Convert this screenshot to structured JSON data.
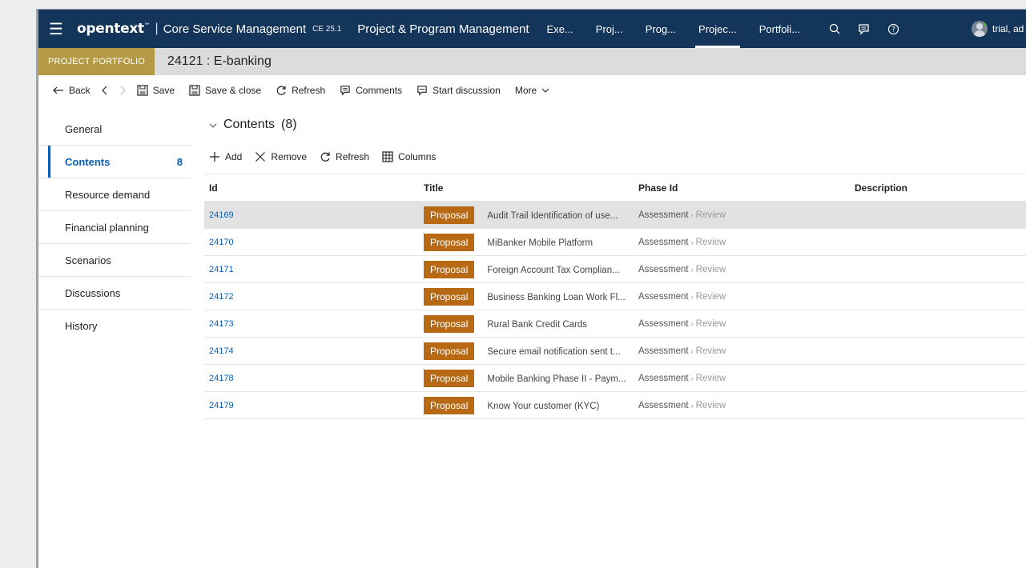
{
  "topbar": {
    "brand": "opentext",
    "product": "Core Service Management",
    "version": "CE 25.1",
    "module": "Project & Program Management",
    "nav": [
      "Exe...",
      "Proj...",
      "Prog...",
      "Projec...",
      "Portfoli..."
    ],
    "user": "trial, ad"
  },
  "titlebar": {
    "badge": "PROJECT PORTFOLIO",
    "title": "24121 : E-banking"
  },
  "toolbar": {
    "back": "Back",
    "save": "Save",
    "save_close": "Save & close",
    "refresh": "Refresh",
    "comments": "Comments",
    "start_discussion": "Start discussion",
    "more": "More"
  },
  "sidebar": {
    "items": [
      {
        "label": "General",
        "count": ""
      },
      {
        "label": "Contents",
        "count": "8"
      },
      {
        "label": "Resource demand",
        "count": ""
      },
      {
        "label": "Financial planning",
        "count": ""
      },
      {
        "label": "Scenarios",
        "count": ""
      },
      {
        "label": "Discussions",
        "count": ""
      },
      {
        "label": "History",
        "count": ""
      }
    ]
  },
  "contents": {
    "heading": "Contents",
    "count": "(8)",
    "actions": {
      "add": "Add",
      "remove": "Remove",
      "refresh": "Refresh",
      "columns": "Columns"
    },
    "columns": [
      "Id",
      "Title",
      "Phase Id",
      "Description"
    ],
    "rows": [
      {
        "id": "24169",
        "badge": "Proposal",
        "title": "Audit Trail Identification of use...",
        "phase": "Assessment",
        "sub": "Review"
      },
      {
        "id": "24170",
        "badge": "Proposal",
        "title": "MiBanker Mobile Platform",
        "phase": "Assessment",
        "sub": "Review"
      },
      {
        "id": "24171",
        "badge": "Proposal",
        "title": "Foreign Account Tax Complian...",
        "phase": "Assessment",
        "sub": "Review"
      },
      {
        "id": "24172",
        "badge": "Proposal",
        "title": "Business Banking Loan Work Fl...",
        "phase": "Assessment",
        "sub": "Review"
      },
      {
        "id": "24173",
        "badge": "Proposal",
        "title": "Rural Bank Credit Cards",
        "phase": "Assessment",
        "sub": "Review"
      },
      {
        "id": "24174",
        "badge": "Proposal",
        "title": "Secure email notification sent t...",
        "phase": "Assessment",
        "sub": "Review"
      },
      {
        "id": "24178",
        "badge": "Proposal",
        "title": "Mobile Banking Phase II - Paym...",
        "phase": "Assessment",
        "sub": "Review"
      },
      {
        "id": "24179",
        "badge": "Proposal",
        "title": "Know Your customer (KYC)",
        "phase": "Assessment",
        "sub": "Review"
      }
    ]
  }
}
